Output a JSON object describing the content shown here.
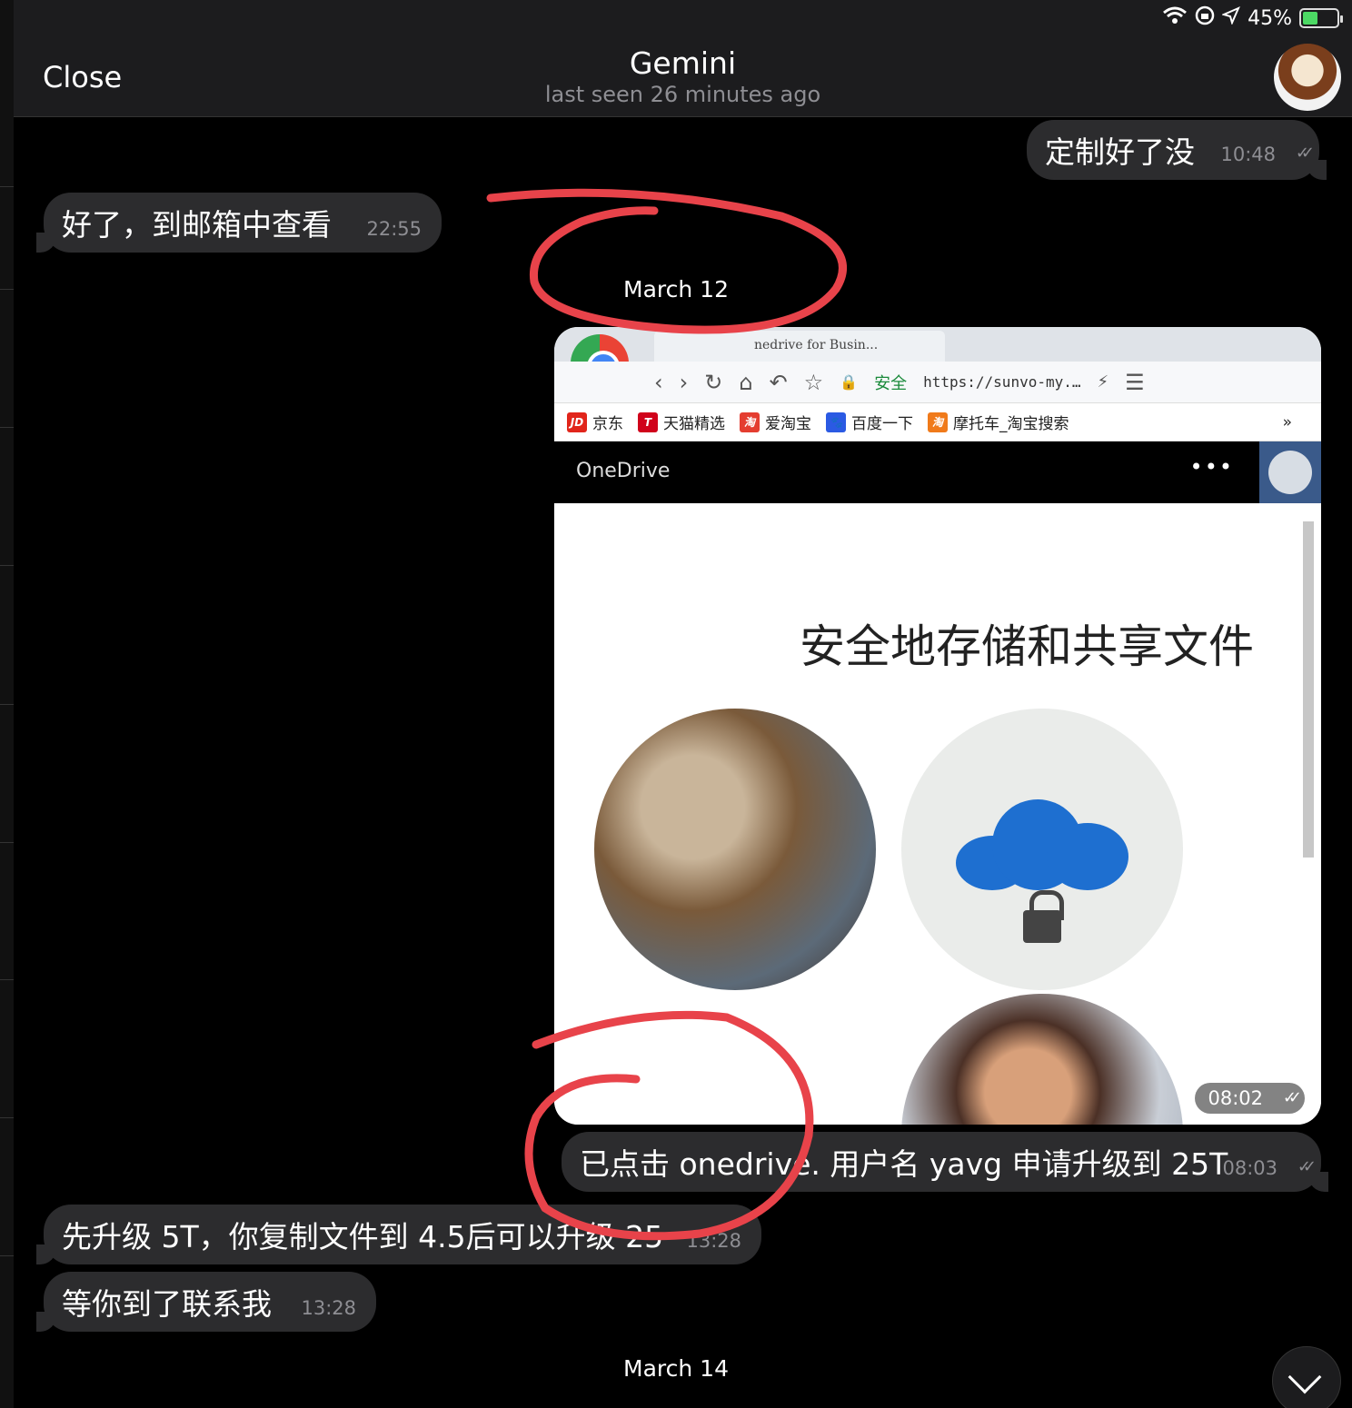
{
  "status": {
    "battery_percent": "45%",
    "battery_level": 0.45,
    "icons": [
      "wifi-icon",
      "orientation-lock-icon",
      "location-icon",
      "battery-charging-icon"
    ]
  },
  "header": {
    "close_label": "Close",
    "title": "Gemini",
    "subtitle": "last seen 26 minutes ago"
  },
  "messages": [
    {
      "dir": "out",
      "text": "定制好了没",
      "time": "10:48"
    },
    {
      "dir": "in",
      "text": "好了，到邮箱中查看",
      "time": "22:55"
    },
    {
      "dir": "out",
      "text": "已点击 onedrive. 用户名 yavg 申请升级到 25T",
      "time": "08:03"
    },
    {
      "dir": "in",
      "text": "先升级 5T，你复制文件到 4.5后可以升级 25",
      "time": "13:28"
    },
    {
      "dir": "in",
      "text": "等你到了联系我",
      "time": "13:28"
    }
  ],
  "dates": {
    "d1": "March 12",
    "d2": "March 14"
  },
  "photo": {
    "time": "08:02",
    "browser": {
      "tab_title": "nedrive for Busin...",
      "secure_label": "安全",
      "url": "https://sunvo-my.…",
      "bookmarks": [
        "京东",
        "天猫精选",
        "爱淘宝",
        "百度一下",
        "摩托车_淘宝搜索"
      ],
      "bookmark_badges": [
        "JD",
        "T",
        "淘",
        "🐾",
        "淘"
      ],
      "more": "»"
    },
    "onedrive": {
      "brand": "OneDrive",
      "dots": "•••",
      "headline": "安全地存储和共享文件"
    }
  },
  "colors": {
    "bubble": "#2c2c2e",
    "annotation": "#e8434a",
    "cloud": "#1e6fd0"
  }
}
